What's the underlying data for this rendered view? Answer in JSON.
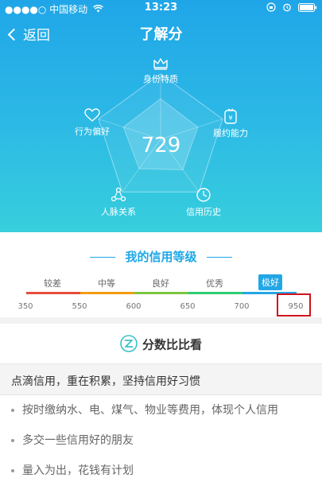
{
  "status": {
    "carrier": "●●●●○ 中国移动",
    "time": "13:23"
  },
  "nav": {
    "back_label": "返回",
    "title": "了解分"
  },
  "radar": {
    "score": "729",
    "dimensions": [
      {
        "label": "身份特质",
        "icon": "crown-icon"
      },
      {
        "label": "履约能力",
        "icon": "wallet-icon"
      },
      {
        "label": "信用历史",
        "icon": "clock-icon"
      },
      {
        "label": "人脉关系",
        "icon": "network-icon"
      },
      {
        "label": "行为偏好",
        "icon": "heart-icon"
      }
    ],
    "dimension_values": [
      0.62,
      0.6,
      0.58,
      0.56,
      0.6
    ]
  },
  "credit_level": {
    "title": "我的信用等级",
    "levels": [
      "较差",
      "中等",
      "良好",
      "优秀",
      "极好"
    ],
    "active_level": "极好",
    "ticks": [
      "350",
      "550",
      "600",
      "650",
      "700",
      "950"
    ],
    "colors": [
      "#e74c3c",
      "#f39c12",
      "#7dc542",
      "#2ecc71",
      "#23a6e6"
    ]
  },
  "compare": {
    "label": "分数比比看",
    "icon": "zhima-logo-icon"
  },
  "tips": {
    "header": "点滴信用，重在积累，坚持信用好习惯",
    "items": [
      "按时缴纳水、电、煤气、物业等费用，体现个人信用",
      "多交一些信用好的朋友",
      "量入为出，花钱有计划"
    ]
  }
}
